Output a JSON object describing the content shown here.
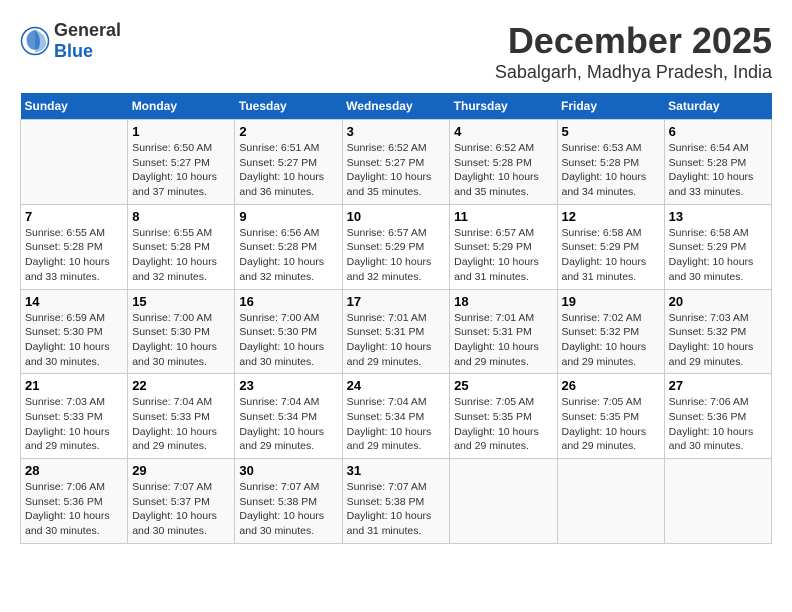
{
  "header": {
    "logo_general": "General",
    "logo_blue": "Blue",
    "month": "December 2025",
    "location": "Sabalgarh, Madhya Pradesh, India"
  },
  "columns": [
    "Sunday",
    "Monday",
    "Tuesday",
    "Wednesday",
    "Thursday",
    "Friday",
    "Saturday"
  ],
  "weeks": [
    [
      {
        "day": "",
        "info": ""
      },
      {
        "day": "1",
        "info": "Sunrise: 6:50 AM\nSunset: 5:27 PM\nDaylight: 10 hours\nand 37 minutes."
      },
      {
        "day": "2",
        "info": "Sunrise: 6:51 AM\nSunset: 5:27 PM\nDaylight: 10 hours\nand 36 minutes."
      },
      {
        "day": "3",
        "info": "Sunrise: 6:52 AM\nSunset: 5:27 PM\nDaylight: 10 hours\nand 35 minutes."
      },
      {
        "day": "4",
        "info": "Sunrise: 6:52 AM\nSunset: 5:28 PM\nDaylight: 10 hours\nand 35 minutes."
      },
      {
        "day": "5",
        "info": "Sunrise: 6:53 AM\nSunset: 5:28 PM\nDaylight: 10 hours\nand 34 minutes."
      },
      {
        "day": "6",
        "info": "Sunrise: 6:54 AM\nSunset: 5:28 PM\nDaylight: 10 hours\nand 33 minutes."
      }
    ],
    [
      {
        "day": "7",
        "info": "Sunrise: 6:55 AM\nSunset: 5:28 PM\nDaylight: 10 hours\nand 33 minutes."
      },
      {
        "day": "8",
        "info": "Sunrise: 6:55 AM\nSunset: 5:28 PM\nDaylight: 10 hours\nand 32 minutes."
      },
      {
        "day": "9",
        "info": "Sunrise: 6:56 AM\nSunset: 5:28 PM\nDaylight: 10 hours\nand 32 minutes."
      },
      {
        "day": "10",
        "info": "Sunrise: 6:57 AM\nSunset: 5:29 PM\nDaylight: 10 hours\nand 32 minutes."
      },
      {
        "day": "11",
        "info": "Sunrise: 6:57 AM\nSunset: 5:29 PM\nDaylight: 10 hours\nand 31 minutes."
      },
      {
        "day": "12",
        "info": "Sunrise: 6:58 AM\nSunset: 5:29 PM\nDaylight: 10 hours\nand 31 minutes."
      },
      {
        "day": "13",
        "info": "Sunrise: 6:58 AM\nSunset: 5:29 PM\nDaylight: 10 hours\nand 30 minutes."
      }
    ],
    [
      {
        "day": "14",
        "info": "Sunrise: 6:59 AM\nSunset: 5:30 PM\nDaylight: 10 hours\nand 30 minutes."
      },
      {
        "day": "15",
        "info": "Sunrise: 7:00 AM\nSunset: 5:30 PM\nDaylight: 10 hours\nand 30 minutes."
      },
      {
        "day": "16",
        "info": "Sunrise: 7:00 AM\nSunset: 5:30 PM\nDaylight: 10 hours\nand 30 minutes."
      },
      {
        "day": "17",
        "info": "Sunrise: 7:01 AM\nSunset: 5:31 PM\nDaylight: 10 hours\nand 29 minutes."
      },
      {
        "day": "18",
        "info": "Sunrise: 7:01 AM\nSunset: 5:31 PM\nDaylight: 10 hours\nand 29 minutes."
      },
      {
        "day": "19",
        "info": "Sunrise: 7:02 AM\nSunset: 5:32 PM\nDaylight: 10 hours\nand 29 minutes."
      },
      {
        "day": "20",
        "info": "Sunrise: 7:03 AM\nSunset: 5:32 PM\nDaylight: 10 hours\nand 29 minutes."
      }
    ],
    [
      {
        "day": "21",
        "info": "Sunrise: 7:03 AM\nSunset: 5:33 PM\nDaylight: 10 hours\nand 29 minutes."
      },
      {
        "day": "22",
        "info": "Sunrise: 7:04 AM\nSunset: 5:33 PM\nDaylight: 10 hours\nand 29 minutes."
      },
      {
        "day": "23",
        "info": "Sunrise: 7:04 AM\nSunset: 5:34 PM\nDaylight: 10 hours\nand 29 minutes."
      },
      {
        "day": "24",
        "info": "Sunrise: 7:04 AM\nSunset: 5:34 PM\nDaylight: 10 hours\nand 29 minutes."
      },
      {
        "day": "25",
        "info": "Sunrise: 7:05 AM\nSunset: 5:35 PM\nDaylight: 10 hours\nand 29 minutes."
      },
      {
        "day": "26",
        "info": "Sunrise: 7:05 AM\nSunset: 5:35 PM\nDaylight: 10 hours\nand 29 minutes."
      },
      {
        "day": "27",
        "info": "Sunrise: 7:06 AM\nSunset: 5:36 PM\nDaylight: 10 hours\nand 30 minutes."
      }
    ],
    [
      {
        "day": "28",
        "info": "Sunrise: 7:06 AM\nSunset: 5:36 PM\nDaylight: 10 hours\nand 30 minutes."
      },
      {
        "day": "29",
        "info": "Sunrise: 7:07 AM\nSunset: 5:37 PM\nDaylight: 10 hours\nand 30 minutes."
      },
      {
        "day": "30",
        "info": "Sunrise: 7:07 AM\nSunset: 5:38 PM\nDaylight: 10 hours\nand 30 minutes."
      },
      {
        "day": "31",
        "info": "Sunrise: 7:07 AM\nSunset: 5:38 PM\nDaylight: 10 hours\nand 31 minutes."
      },
      {
        "day": "",
        "info": ""
      },
      {
        "day": "",
        "info": ""
      },
      {
        "day": "",
        "info": ""
      }
    ]
  ]
}
